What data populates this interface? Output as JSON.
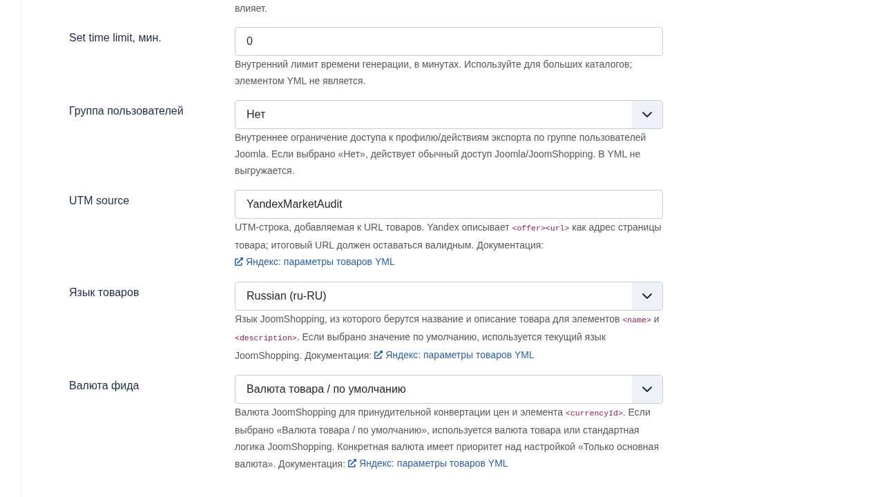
{
  "partial_description": "влияет.",
  "fields": [
    {
      "label": "Set time limit, мин.",
      "kind": "input",
      "value": "0",
      "description": [
        {
          "kind": "text",
          "text": "Внутренний лимит времени генерации, в минутах. Используйте для больших каталогов; элементом YML не является."
        }
      ]
    },
    {
      "label": "Группа пользователей",
      "kind": "select",
      "value": "Нет",
      "description": [
        {
          "kind": "text",
          "text": "Внутреннее ограничение доступа к профилю/действиям экспорта по группе пользователей Joomla. Если выбрано «Нет», действует обычный доступ Joomla/JoomShopping. В YML не выгружается."
        }
      ]
    },
    {
      "label": "UTM source",
      "kind": "input",
      "value": "YandexMarketAudit",
      "description": [
        {
          "kind": "text",
          "text": "UTM-строка, добавляемая к URL товаров. Yandex описывает "
        },
        {
          "kind": "code",
          "text": "<offer><url>"
        },
        {
          "kind": "text",
          "text": " как адрес страницы товара; итоговый URL должен оставаться валидным. Документация: "
        },
        {
          "kind": "link",
          "text": "Яндекс: параметры товаров YML"
        }
      ]
    },
    {
      "label": "Язык товаров",
      "kind": "select",
      "value": "Russian (ru-RU)",
      "description": [
        {
          "kind": "text",
          "text": "Язык JoomShopping, из которого берутся название и описание товара для элементов "
        },
        {
          "kind": "code",
          "text": "<name>"
        },
        {
          "kind": "text",
          "text": " и "
        },
        {
          "kind": "code",
          "text": "<description>"
        },
        {
          "kind": "text",
          "text": ". Если выбрано значение по умолчанию, используется текущий язык JoomShopping. Документация: "
        },
        {
          "kind": "link",
          "text": "Яндекс: параметры товаров YML"
        }
      ]
    },
    {
      "label": "Валюта фида",
      "kind": "select",
      "value": "Валюта товара / по умолчанию",
      "description": [
        {
          "kind": "text",
          "text": "Валюта JoomShopping для принудительной конвертации цен и элемента "
        },
        {
          "kind": "code",
          "text": "<currencyId>"
        },
        {
          "kind": "text",
          "text": ". Если выбрано «Валюта товара / по умолчанию», используется валюта товара или стандартная логика JoomShopping. Конкретная валюта имеет приоритет над настройкой «Только основная валюта». Документация: "
        },
        {
          "kind": "link",
          "text": "Яндекс: параметры товаров YML"
        }
      ]
    }
  ]
}
